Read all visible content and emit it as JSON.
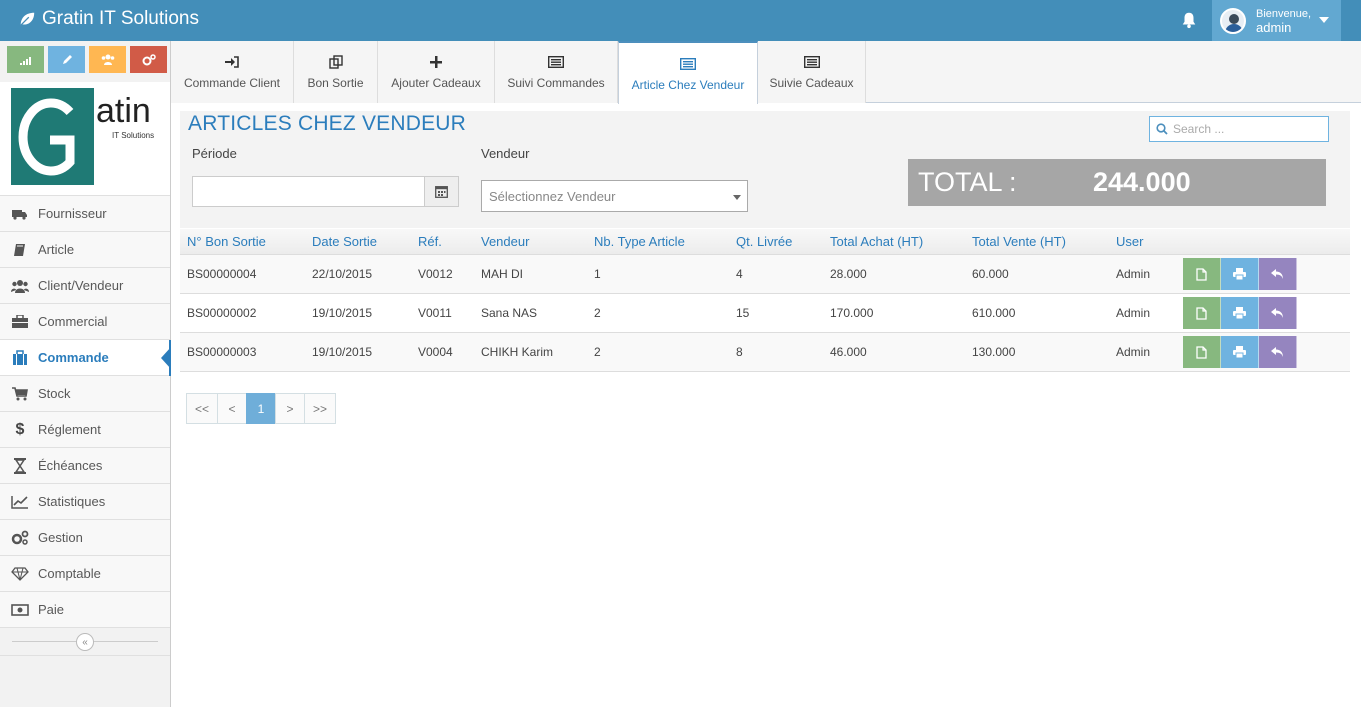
{
  "app": {
    "brand": "Gratin IT Solutions"
  },
  "user": {
    "greeting": "Bienvenue,",
    "name": "admin"
  },
  "colors": {
    "navbar": "#438eb9",
    "accent": "#2b7dbc",
    "total_bg": "#a6a6a6"
  },
  "shortcuts": [
    {
      "icon": "signal-icon",
      "color": "#87b87f"
    },
    {
      "icon": "pencil-icon",
      "color": "#6fb3e0"
    },
    {
      "icon": "users-icon",
      "color": "#ffb752"
    },
    {
      "icon": "cogs-icon",
      "color": "#d15b47"
    }
  ],
  "logo": {
    "big": "G",
    "word": "atin",
    "sub": "IT Solutions"
  },
  "sidebar": {
    "items": [
      {
        "label": "Fournisseur",
        "icon": "truck-icon"
      },
      {
        "label": "Article",
        "icon": "book-icon"
      },
      {
        "label": "Client/Vendeur",
        "icon": "users-icon"
      },
      {
        "label": "Commercial",
        "icon": "briefcase-icon"
      },
      {
        "label": "Commande",
        "icon": "shopping-bag-icon",
        "active": true
      },
      {
        "label": "Stock",
        "icon": "cart-icon"
      },
      {
        "label": "Réglement",
        "icon": "dollar-icon"
      },
      {
        "label": "Échéances",
        "icon": "hourglass-icon"
      },
      {
        "label": "Statistiques",
        "icon": "chart-line-icon"
      },
      {
        "label": "Gestion",
        "icon": "cogs-icon"
      },
      {
        "label": "Comptable",
        "icon": "diamond-icon"
      },
      {
        "label": "Paie",
        "icon": "money-icon"
      }
    ],
    "collapse_glyph": "«"
  },
  "tabs": [
    {
      "label": "Commande Client",
      "icon": "sign-in-icon"
    },
    {
      "label": "Bon Sortie",
      "icon": "copy-icon"
    },
    {
      "label": "Ajouter Cadeaux",
      "icon": "plus-icon"
    },
    {
      "label": "Suivi Commandes",
      "icon": "list-icon"
    },
    {
      "label": "Article Chez Vendeur",
      "icon": "list-icon",
      "active": true
    },
    {
      "label": "Suivie Cadeaux",
      "icon": "list-icon"
    }
  ],
  "page": {
    "title": "ARTICLES CHEZ VENDEUR",
    "search_placeholder": "Search ...",
    "periode_label": "Période",
    "periode_value": "",
    "vendeur_label": "Vendeur",
    "vendeur_placeholder": "Sélectionnez Vendeur",
    "total_label": "TOTAL :",
    "total_value": "244.000"
  },
  "table": {
    "headers": [
      "N° Bon Sortie",
      "Date Sortie",
      "Réf.",
      "Vendeur",
      "Nb. Type Article",
      "Qt. Livrée",
      "Total Achat (HT)",
      "Total Vente (HT)",
      "User"
    ],
    "rows": [
      [
        "BS00000004",
        "22/10/2015",
        "V0012",
        "MAH DI",
        "1",
        "4",
        "28.000",
        "60.000",
        "Admin"
      ],
      [
        "BS00000002",
        "19/10/2015",
        "V0011",
        "Sana NAS",
        "2",
        "15",
        "170.000",
        "610.000",
        "Admin"
      ],
      [
        "BS00000003",
        "19/10/2015",
        "V0004",
        "CHIKH Karim",
        "2",
        "8",
        "46.000",
        "130.000",
        "Admin"
      ]
    ]
  },
  "pagination": {
    "first": "<<",
    "prev": "<",
    "current": "1",
    "next": ">",
    "last": ">>"
  }
}
